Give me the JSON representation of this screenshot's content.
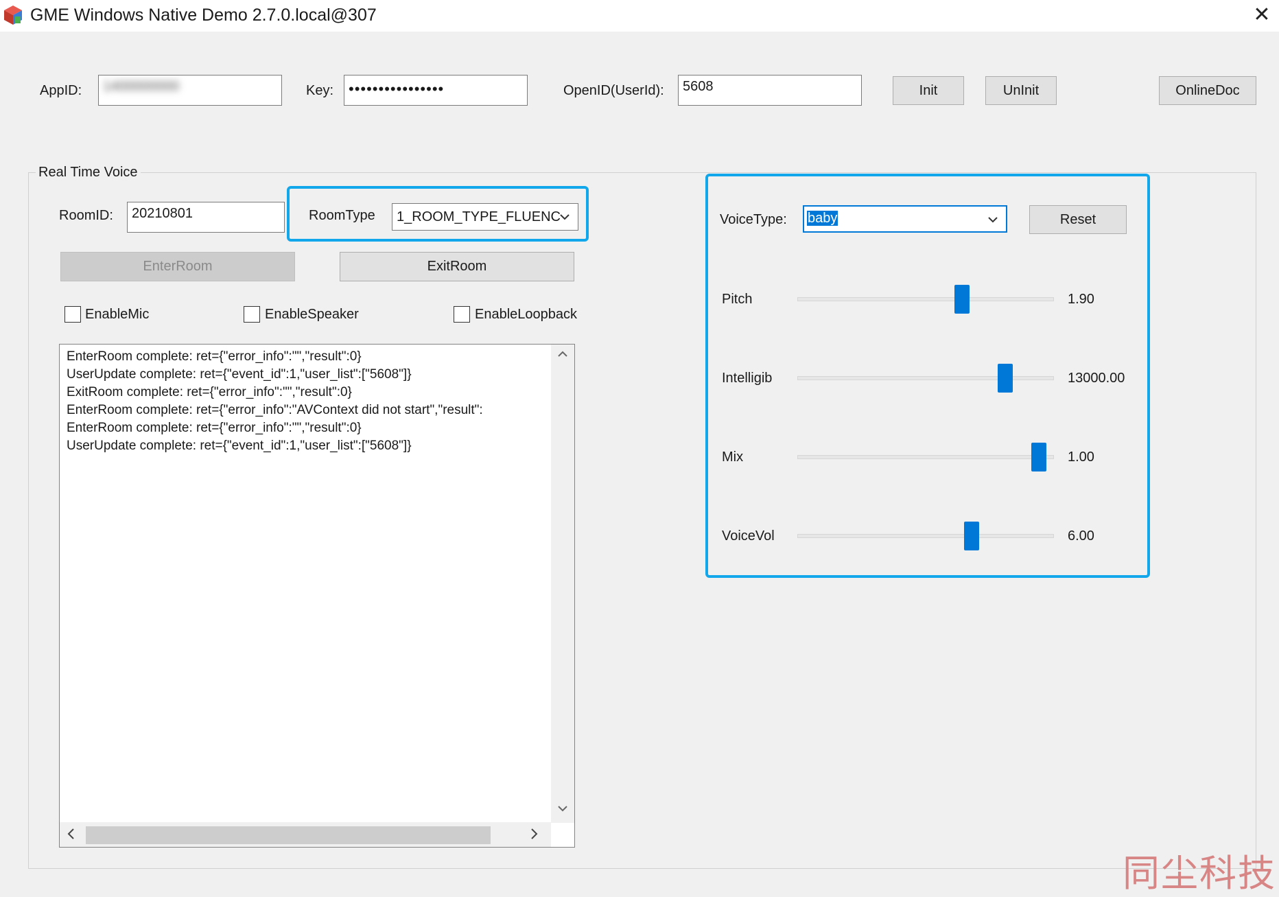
{
  "window": {
    "title": "GME Windows Native Demo 2.7.0.local@307",
    "close_glyph": "✕",
    "icon": "app-cube-icon"
  },
  "credentials": {
    "appid_label": "AppID:",
    "appid_value": "1400000000",
    "key_label": "Key:",
    "key_value": "••••••••••••••••",
    "openid_label": "OpenID(UserId):",
    "openid_value": "5608"
  },
  "top_buttons": {
    "init": "Init",
    "uninit": "UnInit",
    "online_doc": "OnlineDoc"
  },
  "realtime": {
    "group_title": "Real Time Voice",
    "roomid_label": "RoomID:",
    "roomid_value": "20210801",
    "roomtype_label": "RoomType",
    "roomtype_value": "1_ROOM_TYPE_FLUENC",
    "enter_room": "EnterRoom",
    "exit_room": "ExitRoom",
    "enable_mic": "EnableMic",
    "enable_speaker": "EnableSpeaker",
    "enable_loopback": "EnableLoopback",
    "checkboxes_checked": {
      "mic": false,
      "speaker": false,
      "loopback": false
    }
  },
  "log": {
    "lines": [
      "EnterRoom complete: ret={\"error_info\":\"\",\"result\":0}",
      "UserUpdate complete: ret={\"event_id\":1,\"user_list\":[\"5608\"]}",
      "ExitRoom complete: ret={\"error_info\":\"\",\"result\":0}",
      "EnterRoom complete: ret={\"error_info\":\"AVContext did not start\",\"result\":",
      "EnterRoom complete: ret={\"error_info\":\"\",\"result\":0}",
      "UserUpdate complete: ret={\"event_id\":1,\"user_list\":[\"5608\"]}"
    ]
  },
  "voice": {
    "voicetype_label": "VoiceType:",
    "voicetype_value": "baby",
    "reset": "Reset",
    "sliders": [
      {
        "label": "Pitch",
        "value_text": "1.90",
        "level": 0.65
      },
      {
        "label": "Intelligib",
        "value_text": "13000.00",
        "level": 0.83
      },
      {
        "label": "Mix",
        "value_text": "1.00",
        "level": 0.97
      },
      {
        "label": "VoiceVol",
        "value_text": "6.00",
        "level": 0.69
      }
    ]
  },
  "highlight_color": "#11a7ea",
  "watermark": "同尘科技"
}
